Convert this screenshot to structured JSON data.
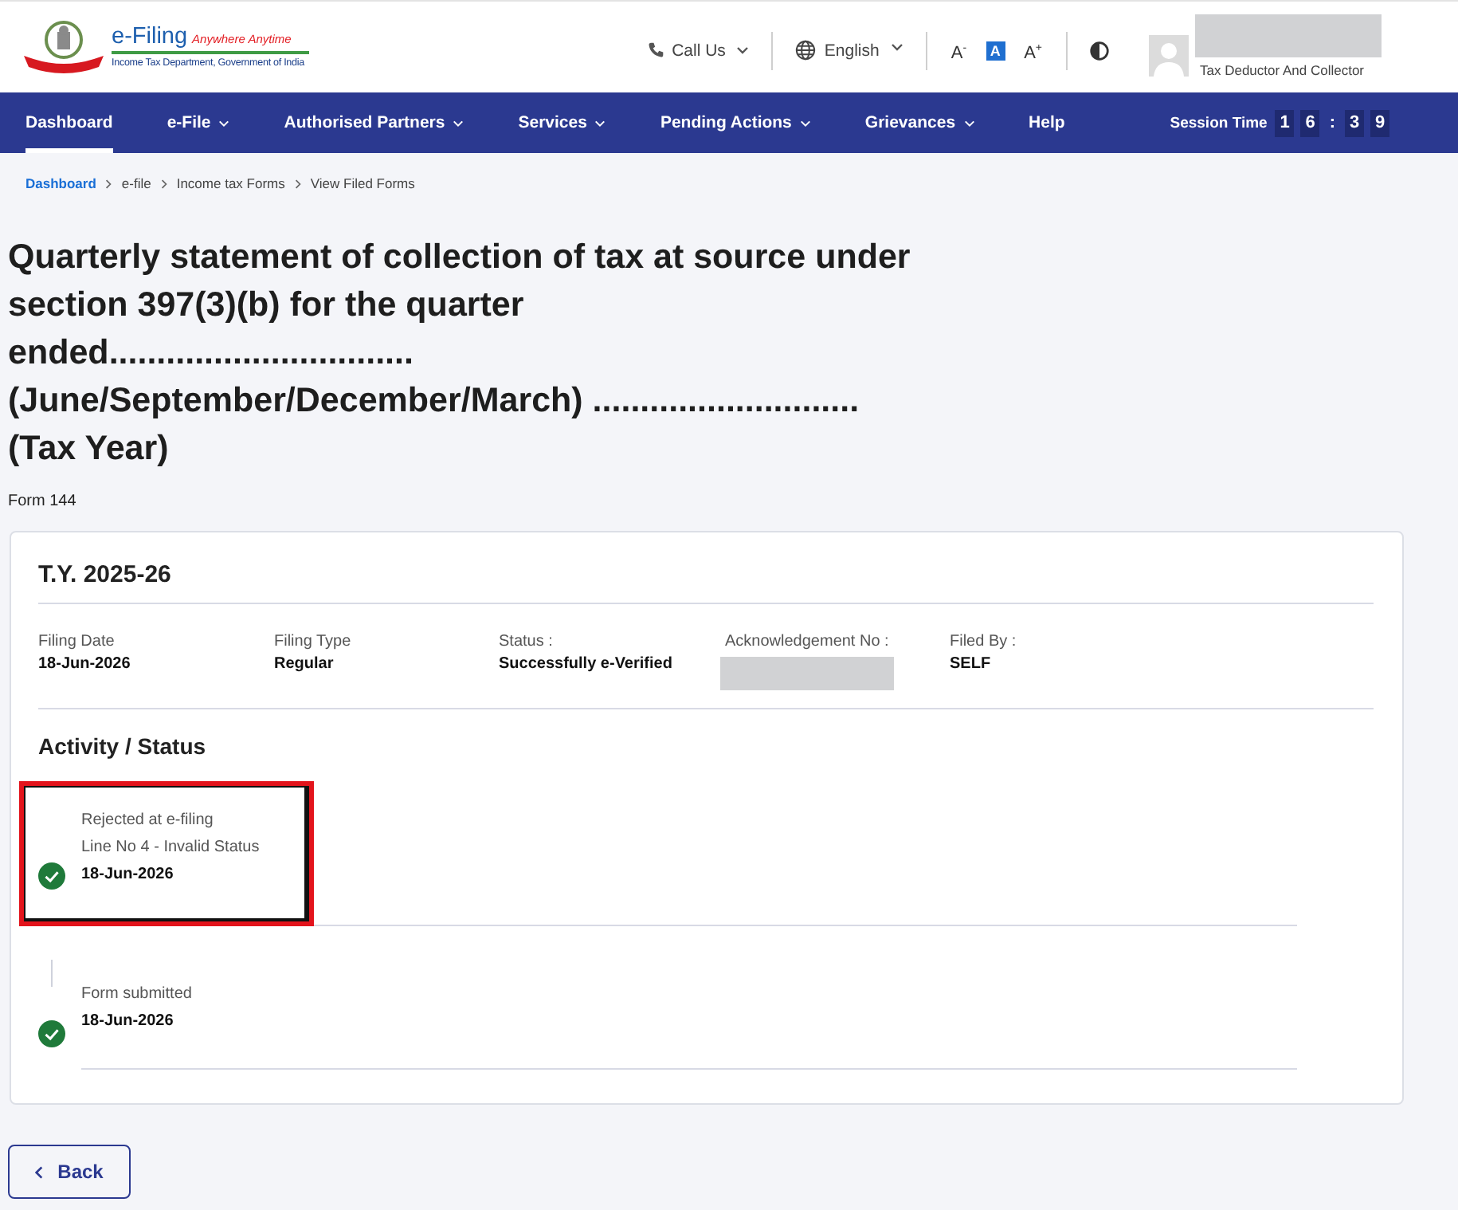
{
  "header": {
    "logo": {
      "title": "e-Filing",
      "tagline": "Anywhere Anytime",
      "subtitle": "Income Tax Department, Government of India"
    },
    "utilities": {
      "call_us": "Call Us",
      "language": "English"
    },
    "font_sizes": [
      {
        "label": "A$^{-}$",
        "selected": false
      },
      {
        "label": "A",
        "selected": true
      },
      {
        "label": "A$^{+}$",
        "selected": false
      }
    ],
    "user": {
      "name_redacted": true,
      "role": "Tax Deductor And Collector"
    }
  },
  "nav": {
    "items": [
      {
        "label": "Dashboard",
        "selected": true,
        "dropdown": false
      },
      {
        "label": "e-File",
        "selected": false,
        "dropdown": true
      },
      {
        "label": "Authorised Partners",
        "selected": false,
        "dropdown": true
      },
      {
        "label": "Services",
        "selected": false,
        "dropdown": true
      },
      {
        "label": "Pending Actions",
        "selected": false,
        "dropdown": true
      },
      {
        "label": "Grievances",
        "selected": false,
        "dropdown": true
      },
      {
        "label": "Help",
        "selected": false,
        "dropdown": false
      }
    ],
    "session_time": {
      "label": "Session Time",
      "digits": [
        {
          "text": "1",
          "kind": "digit"
        },
        {
          "text": "6",
          "kind": "digit"
        },
        {
          "text": ":",
          "kind": "separator"
        },
        {
          "text": "3",
          "kind": "digit"
        },
        {
          "text": "9",
          "kind": "digit"
        }
      ]
    }
  },
  "breadcrumb": [
    {
      "label": "Dashboard",
      "link": true
    },
    {
      "label": "e-file",
      "link": false
    },
    {
      "label": "Income tax Forms",
      "link": false
    },
    {
      "label": "View Filed Forms",
      "link": false
    }
  ],
  "page_title": "Quarterly statement of collection of tax at source under\nsection 397(3)(b) for the quarter\nended................................\n(June/September/December/March) ............................\n(Tax Year)",
  "form_number": "Form 144",
  "filing": {
    "title": "T.Y. 2025-26",
    "fields": [
      {
        "label": "Filing Date",
        "value": "18-Jun-2026",
        "redacted": false
      },
      {
        "label": "Filing Type",
        "value": "Regular",
        "redacted": false
      },
      {
        "label": "Status :",
        "value": "Successfully e-Verified",
        "redacted": false
      },
      {
        "label": "Acknowledgement No :",
        "redacted": true
      },
      {
        "label": "Filed By :",
        "value": "SELF",
        "redacted": false
      }
    ],
    "activity": {
      "title": "Activity / Status",
      "items": [
        {
          "lines": [
            "Rejected at e-filing",
            "Line No 4 - Invalid Status"
          ],
          "date": "18-Jun-2026",
          "done": true,
          "highlighted": true
        },
        {
          "lines": [
            "Form submitted"
          ],
          "date": "18-Jun-2026",
          "done": true,
          "highlighted": false
        }
      ]
    }
  },
  "back_button": {
    "label": "Back"
  }
}
